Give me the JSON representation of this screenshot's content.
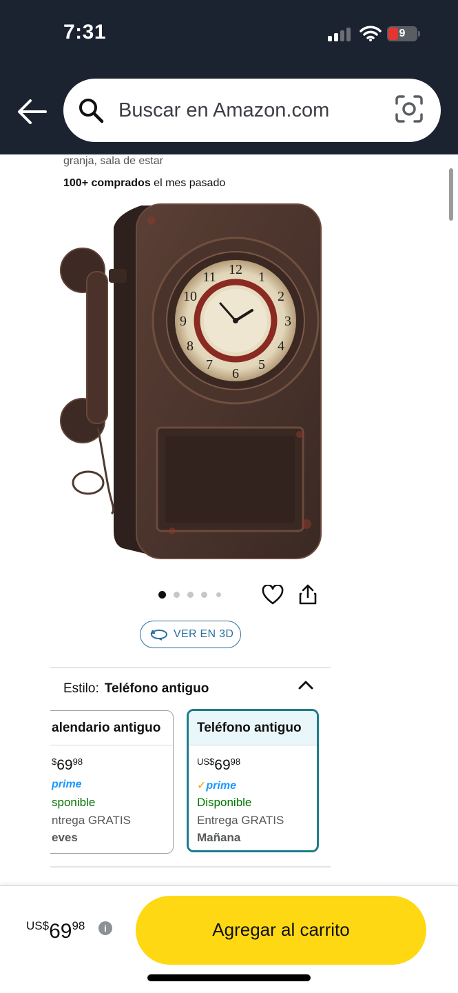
{
  "status_bar": {
    "time": "7:31",
    "battery_level": "9",
    "icons": [
      "cellular-signal-icon",
      "wifi-icon",
      "battery-icon"
    ]
  },
  "search": {
    "placeholder": "Buscar en Amazon.com",
    "icons": [
      "back-arrow-icon",
      "search-icon",
      "camera-lens-icon"
    ]
  },
  "product": {
    "subtitle_fragment": "granja, sala de estar",
    "bought_bold": "100+ comprados",
    "bought_rest": " el mes pasado",
    "image_description_icon": "antique-telephone-clock-image",
    "carousel_total": 5,
    "carousel_active": 1
  },
  "actions": {
    "view_3d": "VER EN 3D",
    "icons": [
      "heart-icon",
      "share-icon",
      "rotate-3d-icon"
    ]
  },
  "style_selector": {
    "label": "Estilo:",
    "value": "Teléfono antiguo",
    "options": [
      {
        "title": "alendario antiguo",
        "price_symbol": "$",
        "price_whole": "69",
        "price_cents": "98",
        "prime": "prime",
        "availability": "sponible",
        "shipping": "ntrega GRATIS",
        "delivery_day": "eves",
        "selected": false
      },
      {
        "title": "Teléfono antiguo",
        "price_symbol": "US$",
        "price_whole": "69",
        "price_cents": "98",
        "prime": "prime",
        "availability": "Disponible",
        "shipping": "Entrega GRATIS",
        "delivery_day": "Mañana",
        "selected": true
      }
    ]
  },
  "buy_bar": {
    "price_symbol": "US$",
    "price_whole": "69",
    "price_cents": "98",
    "info": "i",
    "add_to_cart": "Agregar al carrito",
    "button_color": "#ffd814"
  },
  "colors": {
    "header_bg": "#1b2230",
    "link_blue": "#2c6f9f",
    "available_green": "#007600",
    "prime_blue": "#1a98ff",
    "selected_border": "#1b7d8a"
  }
}
